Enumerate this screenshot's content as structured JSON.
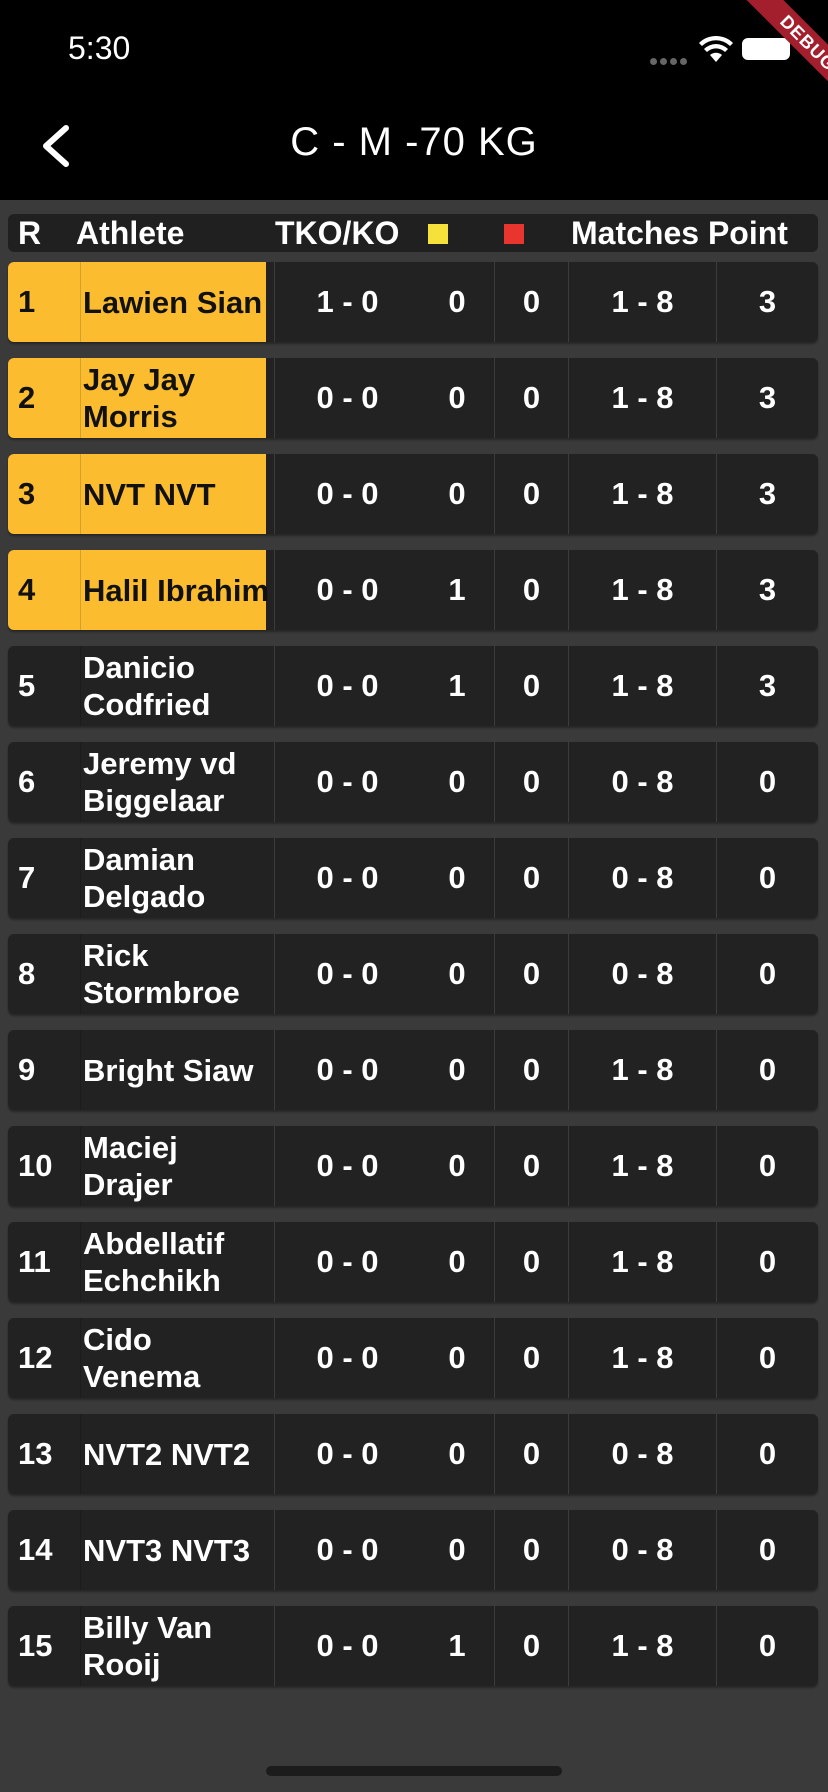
{
  "status": {
    "time": "5:30",
    "debug": "DEBUG"
  },
  "nav": {
    "title": "C - M -70 KG"
  },
  "table": {
    "headers": {
      "rank": "R",
      "athlete": "Athlete",
      "tko": "TKO/KO",
      "matches_point": "Matches Point"
    },
    "card_colors": {
      "yellow": "#f5e13a",
      "red": "#e8362f"
    },
    "highlight_color": "#fbbd2f",
    "rows": [
      {
        "rank": "1",
        "name": "Lawien Sian",
        "tko": "1 - 0",
        "yellow": "0",
        "red": "0",
        "matches": "1 - 8",
        "points": "3",
        "highlighted": true
      },
      {
        "rank": "2",
        "name": "Jay Jay Morris",
        "tko": "0 - 0",
        "yellow": "0",
        "red": "0",
        "matches": "1 - 8",
        "points": "3",
        "highlighted": true
      },
      {
        "rank": "3",
        "name": "NVT NVT",
        "tko": "0 - 0",
        "yellow": "0",
        "red": "0",
        "matches": "1 - 8",
        "points": "3",
        "highlighted": true
      },
      {
        "rank": "4",
        "name": "Halil Ibrahim",
        "tko": "0 - 0",
        "yellow": "1",
        "red": "0",
        "matches": "1 - 8",
        "points": "3",
        "highlighted": true
      },
      {
        "rank": "5",
        "name": "Danicio Codfried",
        "tko": "0 - 0",
        "yellow": "1",
        "red": "0",
        "matches": "1 - 8",
        "points": "3",
        "highlighted": false
      },
      {
        "rank": "6",
        "name": "Jeremy vd Biggelaar",
        "tko": "0 - 0",
        "yellow": "0",
        "red": "0",
        "matches": "0 - 8",
        "points": "0",
        "highlighted": false
      },
      {
        "rank": "7",
        "name": "Damian Delgado",
        "tko": "0 - 0",
        "yellow": "0",
        "red": "0",
        "matches": "0 - 8",
        "points": "0",
        "highlighted": false
      },
      {
        "rank": "8",
        "name": "Rick Stormbroe",
        "tko": "0 - 0",
        "yellow": "0",
        "red": "0",
        "matches": "0 - 8",
        "points": "0",
        "highlighted": false
      },
      {
        "rank": "9",
        "name": "Bright Siaw",
        "tko": "0 - 0",
        "yellow": "0",
        "red": "0",
        "matches": "1 - 8",
        "points": "0",
        "highlighted": false
      },
      {
        "rank": "10",
        "name": "Maciej Drajer",
        "tko": "0 - 0",
        "yellow": "0",
        "red": "0",
        "matches": "1 - 8",
        "points": "0",
        "highlighted": false
      },
      {
        "rank": "11",
        "name": "Abdellatif Echchikh",
        "tko": "0 - 0",
        "yellow": "0",
        "red": "0",
        "matches": "1 - 8",
        "points": "0",
        "highlighted": false
      },
      {
        "rank": "12",
        "name": "Cido Venema",
        "tko": "0 - 0",
        "yellow": "0",
        "red": "0",
        "matches": "1 - 8",
        "points": "0",
        "highlighted": false
      },
      {
        "rank": "13",
        "name": "NVT2 NVT2",
        "tko": "0 - 0",
        "yellow": "0",
        "red": "0",
        "matches": "0 - 8",
        "points": "0",
        "highlighted": false
      },
      {
        "rank": "14",
        "name": "NVT3 NVT3",
        "tko": "0 - 0",
        "yellow": "0",
        "red": "0",
        "matches": "0 - 8",
        "points": "0",
        "highlighted": false
      },
      {
        "rank": "15",
        "name": "Billy Van Rooij",
        "tko": "0 - 0",
        "yellow": "1",
        "red": "0",
        "matches": "1 - 8",
        "points": "0",
        "highlighted": false
      }
    ]
  }
}
